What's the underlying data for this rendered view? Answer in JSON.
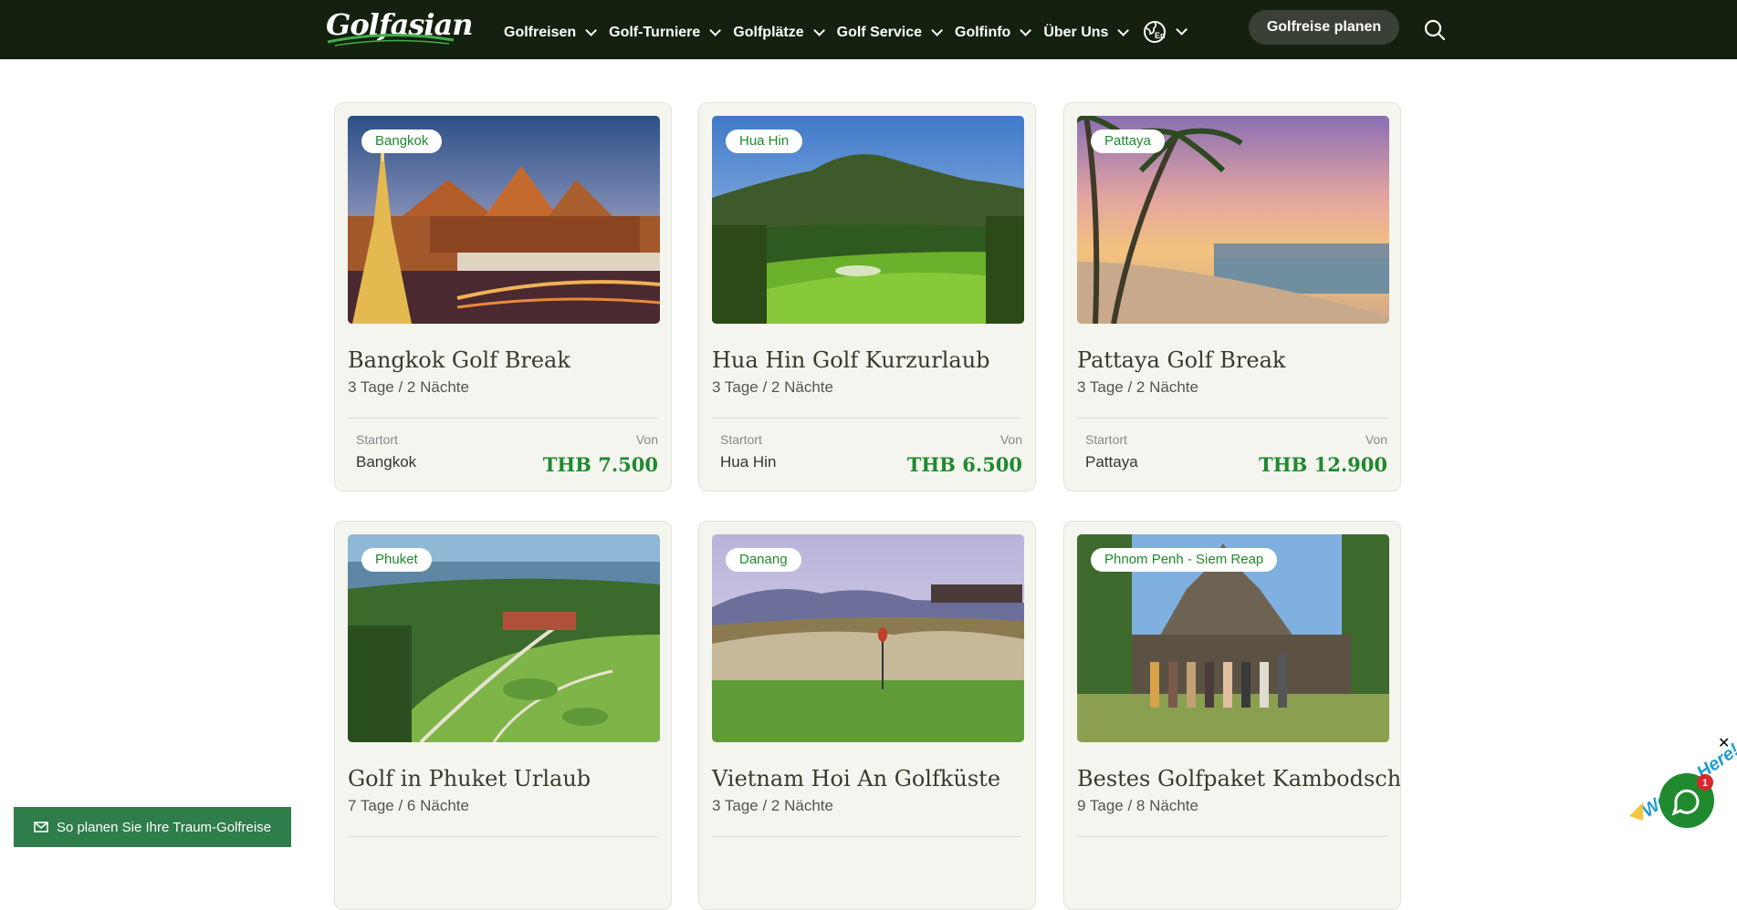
{
  "header": {
    "logo_text": "Golfasian",
    "nav": [
      "Golfreisen",
      "Golf-Turniere",
      "Golfplätze",
      "Golf Service",
      "Golfinfo",
      "Über Uns"
    ],
    "language_label": "En",
    "plan_button": "Golfreise planen"
  },
  "cards": [
    {
      "badge": "Bangkok",
      "title": "Bangkok Golf Break",
      "duration": "3 Tage / 2 Nächte",
      "start_label": "Startort",
      "start": "Bangkok",
      "from_label": "Von",
      "price": "THB 7.500"
    },
    {
      "badge": "Hua Hin",
      "title": "Hua Hin Golf Kurzurlaub",
      "duration": "3 Tage / 2 Nächte",
      "start_label": "Startort",
      "start": "Hua Hin",
      "from_label": "Von",
      "price": "THB 6.500"
    },
    {
      "badge": "Pattaya",
      "title": "Pattaya Golf Break",
      "duration": "3 Tage / 2 Nächte",
      "start_label": "Startort",
      "start": "Pattaya",
      "from_label": "Von",
      "price": "THB 12.900"
    },
    {
      "badge": "Phuket",
      "title": "Golf in Phuket Urlaub",
      "duration": "7 Tage / 6 Nächte"
    },
    {
      "badge": "Danang",
      "title": "Vietnam Hoi An Golfküste",
      "duration": "3 Tage / 2 Nächte"
    },
    {
      "badge": "Phnom Penh - Siem Reap",
      "title": "Bestes Golfpaket Kambodscha",
      "duration": "9 Tage / 8 Nächte"
    }
  ],
  "bottom_button": "So planen Sie Ihre Traum-Golfreise",
  "chat": {
    "label": "We Are Here!",
    "count": "1",
    "close": "✕"
  },
  "colors": {
    "header_bg": "#15210f",
    "accent_green": "#1f8a2e",
    "cta_green": "#2e7d4a"
  }
}
